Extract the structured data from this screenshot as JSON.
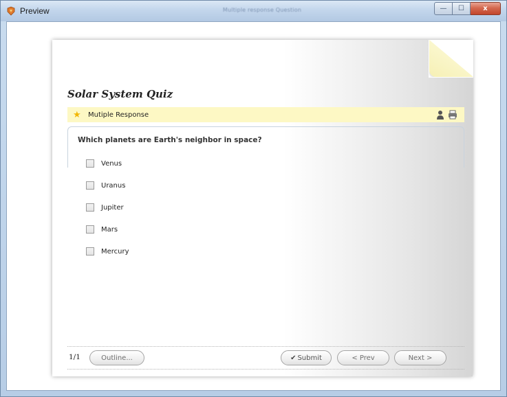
{
  "window": {
    "title": "Preview",
    "center_title": "Multiple response Question",
    "buttons": {
      "minimize": "—",
      "maximize": "☐",
      "close": "x"
    }
  },
  "quiz": {
    "title": "Solar System Quiz",
    "question_type": "Mutiple Response",
    "question": "Which planets are Earth's neighbor in space?",
    "options": [
      "Venus",
      "Uranus",
      "Jupiter",
      "Mars",
      "Mercury"
    ],
    "pager": "1/1",
    "buttons": {
      "outline": "Outline...",
      "submit": "Submit",
      "prev": "< Prev",
      "next": "Next >"
    }
  },
  "icons": {
    "app": "preview-app-icon",
    "type": "star-icon",
    "user": "person-icon",
    "print": "printer-icon",
    "submit": "checkmark-icon"
  },
  "colors": {
    "type_bar": "#fdf8c4",
    "fold": "#f6f0b5",
    "close_button": "#c2452b"
  }
}
